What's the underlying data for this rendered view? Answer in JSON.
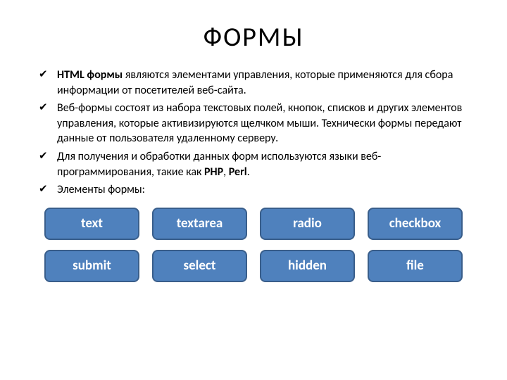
{
  "title": "ФОРМЫ",
  "bullets": [
    {
      "prefix": "HTML формы",
      "rest": " являются элементами управления, которые применяются для сбора информации от посетителей веб-сайта."
    },
    {
      "prefix": "",
      "rest": "Веб-формы состоят из набора текстовых полей, кнопок, списков и других элементов управления, которые активизируются щелчком мыши. Технически формы передают данные от пользователя удаленному серверу."
    },
    {
      "prefix": "",
      "rest": "Для получения и обработки данных форм используются языки веб-программирования, такие как ",
      "bold2": "PHP",
      "mid": ", ",
      "bold3": "Perl",
      "suffix": "."
    },
    {
      "prefix": "",
      "rest": "Элементы формы:"
    }
  ],
  "elements": [
    "text",
    "textarea",
    "radio",
    "checkbox",
    "submit",
    "select",
    "hidden",
    "file"
  ]
}
